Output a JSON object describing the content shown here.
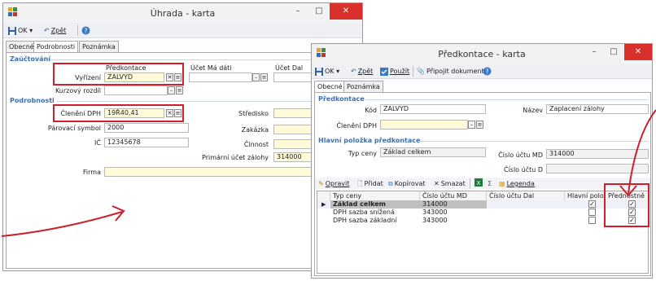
{
  "win1": {
    "title": "Úhrada - karta",
    "toolbar": {
      "ok": "OK",
      "back": "Zpět"
    },
    "tabs": [
      "Obecné",
      "Podrobnosti",
      "Poznámka"
    ],
    "sec_zauct": "Zaúčtování",
    "col_predkontace": "Předkontace",
    "col_ucet_ma_dati": "Účet Má dáti",
    "col_ucet_dal": "Účet Dal",
    "vyrizeni_label": "Vyřízení",
    "vyrizeni_value": "ZALVYD",
    "kurzovy_label": "Kurzový rozdíl",
    "sec_podrobnosti": "Podrobnosti",
    "cleneni_label": "Členění DPH",
    "cleneni_value": "19Ř40,41",
    "parovaci_label": "Párovací symbol",
    "parovaci_value": "2000",
    "ic_label": "IČ",
    "ic_value": "12345678",
    "stredisko_label": "Středisko",
    "zakazka_label": "Zakázka",
    "cinnost_label": "Činnost",
    "primarni_label": "Primární účet zálohy",
    "primarni_value": "314000",
    "firma_label": "Firma"
  },
  "win2": {
    "title": "Předkontace - karta",
    "toolbar": {
      "ok": "OK",
      "back": "Zpět",
      "use": "Použít",
      "attach": "Připojit dokument"
    },
    "tabs": [
      "Obecné",
      "Poznámka"
    ],
    "sec_predkontace": "Předkontace",
    "kod_label": "Kód",
    "kod_value": "ZALVYD",
    "nazev_label": "Název",
    "nazev_value": "Zaplacení zálohy",
    "cleneni_label": "Členění DPH",
    "sec_hlavni": "Hlavní položka předkontace",
    "typ_ceny_label": "Typ ceny",
    "typ_ceny_value": "Základ celkem",
    "cislo_md_label": "Číslo účtu MD",
    "cislo_md_value": "314000",
    "cislo_d_label": "Číslo účtu D",
    "grid_toolbar": {
      "edit": "Opravit",
      "add": "Přidat",
      "copy": "Kopírovat",
      "delete": "Smazat",
      "legend": "Legenda"
    },
    "grid_headers": [
      "Typ ceny",
      "Číslo účtu MD",
      "Číslo účtu Dal",
      "Hlavní polo...",
      "Přednostně"
    ],
    "grid_rows": [
      {
        "typ": "Základ celkem",
        "md": "314000",
        "dal": ""
      },
      {
        "typ": "DPH sazba snížená",
        "md": "343000",
        "dal": ""
      },
      {
        "typ": "DPH sazba základní",
        "md": "343000",
        "dal": ""
      }
    ]
  },
  "colors": {
    "highlight": "#d01f2b",
    "section": "#3b6fb6",
    "close": "#d9302c",
    "yellow_field": "#fffbd9"
  },
  "icons": [
    "app-icon",
    "save-icon",
    "undo-icon",
    "help-icon",
    "use-icon",
    "attach-icon",
    "edit-icon",
    "add-icon",
    "copy-icon",
    "delete-icon",
    "excel-icon",
    "sum-icon",
    "legend-icon",
    "row-pointer-icon",
    "checkbox-icon"
  ]
}
